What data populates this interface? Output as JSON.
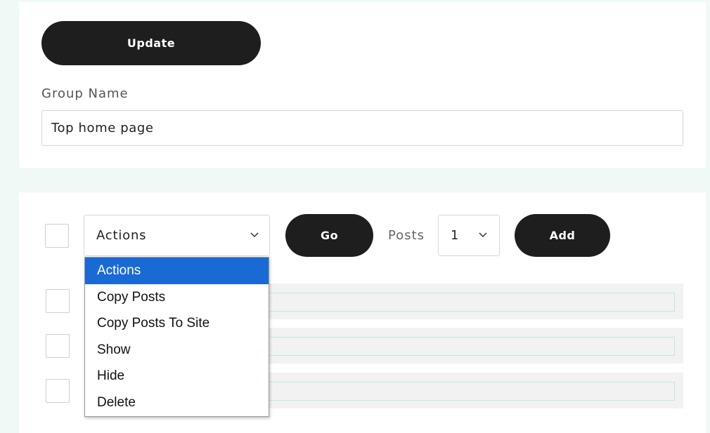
{
  "top_panel": {
    "update_label": "Update",
    "group_name_label": "Group Name",
    "group_name_value": "Top home page"
  },
  "toolbar": {
    "actions_selected": "Actions",
    "go_label": "Go",
    "posts_label": "Posts",
    "posts_selected": "1",
    "add_label": "Add"
  },
  "actions_dropdown": {
    "options": [
      "Actions",
      "Copy Posts",
      "Copy Posts To Site",
      "Show",
      "Hide",
      "Delete"
    ],
    "highlighted": "Actions"
  },
  "post_rows": [
    {
      "field_value": ""
    },
    {
      "field_value": ""
    },
    {
      "field_value": ""
    }
  ],
  "colors": {
    "page_bg": "#effaf6",
    "button_bg": "#1e1e1e",
    "highlight": "#1a6ad6",
    "field_border": "#bfeadb"
  }
}
